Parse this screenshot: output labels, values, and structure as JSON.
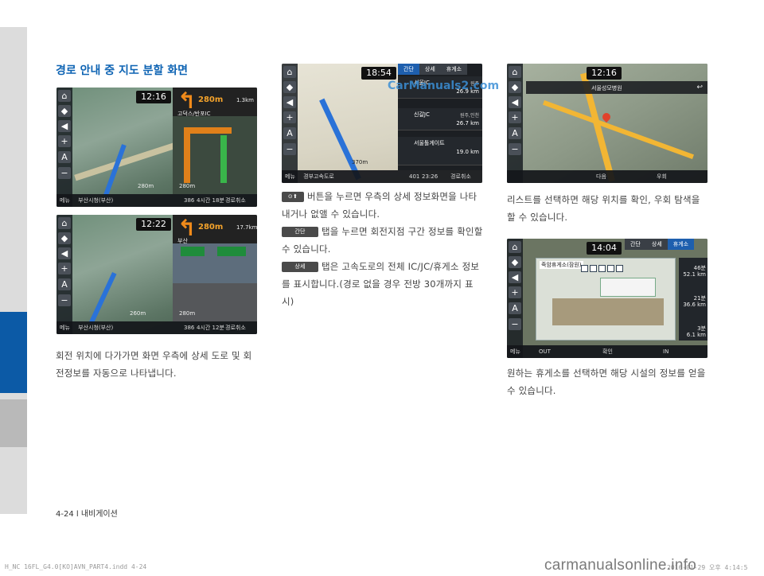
{
  "section_title": "경로 안내 중 지도 분할 화면",
  "screen1": {
    "clock": "12:16",
    "turn_distance": "280m",
    "next_distance": "1.3km",
    "ic_label": "고덕스/반포IC",
    "small_dist": "280m",
    "menu": "메뉴",
    "location": "부산시청(부산)",
    "eta_dist": "386",
    "eta_time": "4시간 18분",
    "cancel": "경로취소",
    "remaining": "280m"
  },
  "screen2": {
    "clock": "12:22",
    "turn_distance": "280m",
    "next_distance": "17.7km",
    "ic_label": "부산",
    "small_dist": "260m",
    "menu": "메뉴",
    "location": "부산시청(부산)",
    "eta_dist": "386",
    "eta_time": "4시간 12분",
    "cancel": "경로취소",
    "remaining": "280m"
  },
  "caption_left": "회전 위치에 다가가면 화면 우측에 상세 도로 및 회전정보를 자동으로 나타냅니다.",
  "screen3": {
    "clock": "18:54",
    "tabs": [
      "간단",
      "상세",
      "휴게소"
    ],
    "items": [
      {
        "name": "서울JC",
        "dir": "원주",
        "dist": "26.9 km"
      },
      {
        "name": "신갈JC",
        "dir": "원주,인천",
        "dist": "26.7 km"
      },
      {
        "name": "서울톨게이트",
        "dir": "",
        "dist": "19.0 km"
      }
    ],
    "menu": "메뉴",
    "road": "경부고속도로",
    "route_dist": "370m",
    "eta_dist": "401",
    "eta_time": "23:26",
    "cancel": "경로취소"
  },
  "watermark": "CarManuals2.com",
  "caption_mid": {
    "line1_suffix": "버튼을 누르면 우측의 상세 정보화면을 나타내거나 없앨 수 있습니다.",
    "btn_simple": "간단",
    "line2_suffix": "탭을 누르면 회전지점 구간 정보를 확인할 수 있습니다.",
    "btn_detail": "상세",
    "line3_suffix": "탭은 고속도로의 전체 IC/JC/휴게소 정보를 표시합니다.(경로 없을 경우 전방 30개까지 표시)"
  },
  "screen4": {
    "clock": "12:16",
    "place": "서울성모병원",
    "next": "다음",
    "detour": "우회"
  },
  "caption_right_top": "리스트를 선택하면 해당 위치를 확인, 우회 탐색을 할 수 있습니다.",
  "screen5": {
    "clock": "14:04",
    "tabs": [
      "간단",
      "상세",
      "휴게소"
    ],
    "dialog_title": "죽암휴게소(잠원)",
    "side_items": [
      {
        "time": "46분",
        "dist": "52.1 km"
      },
      {
        "time": "21분",
        "dist": "36.6 km"
      },
      {
        "time": "3분",
        "dist": "6.1 km"
      }
    ],
    "menu": "메뉴",
    "out": "OUT",
    "in": "IN",
    "confirm": "확인"
  },
  "caption_right_bottom": "원하는 휴게소를 선택하면 해당 시설의 정보를 얻을 수 있습니다.",
  "footer": {
    "page": "4-24 l 내비게이션",
    "file": "H_NC 16FL_G4.0[KO]AVN_PART4.indd   4-24",
    "date": "2016-01-29   오후 4:14:5",
    "site": "carmanualsonline.info"
  }
}
